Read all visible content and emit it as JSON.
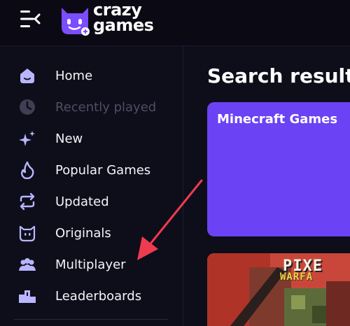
{
  "logo": {
    "line1": "crazy",
    "line2": "games"
  },
  "sidebar": {
    "items": [
      {
        "label": "Home",
        "icon": "home-icon",
        "dim": false
      },
      {
        "label": "Recently played",
        "icon": "clock-icon",
        "dim": true
      },
      {
        "label": "New",
        "icon": "sparkle-icon",
        "dim": false
      },
      {
        "label": "Popular Games",
        "icon": "flame-icon",
        "dim": false
      },
      {
        "label": "Updated",
        "icon": "refresh-icon",
        "dim": false
      },
      {
        "label": "Originals",
        "icon": "originals-icon",
        "dim": false
      },
      {
        "label": "Multiplayer",
        "icon": "users-icon",
        "dim": false
      },
      {
        "label": "Leaderboards",
        "icon": "podium-icon",
        "dim": false
      }
    ]
  },
  "main": {
    "heading": "Search result",
    "cards": [
      {
        "title": "Minecraft Games"
      },
      {
        "title_line1": "PIXE",
        "title_line2": "WARFA"
      }
    ]
  },
  "colors": {
    "accent": "#6b42f4",
    "background": "#0e0d1a",
    "topbar": "#0b0a14",
    "annotation_arrow": "#ee3b4f"
  }
}
